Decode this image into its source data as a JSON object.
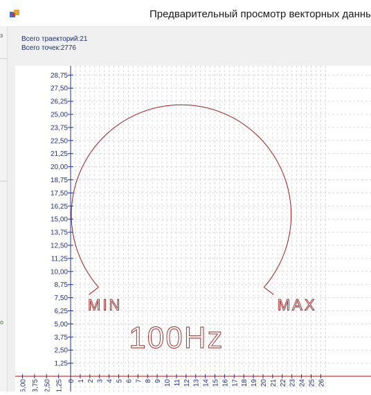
{
  "window": {
    "title": "Предварительный просмотр векторных данны"
  },
  "info": {
    "trajectories_label": "Всего траекторий:21",
    "points_label": "Всего точек:2776"
  },
  "side_fragments": [
    "з",
    "о"
  ],
  "chart_data": {
    "type": "line",
    "title": "",
    "xlabel": "",
    "ylabel": "",
    "grid": true,
    "xlim": [
      -5.0,
      26.5
    ],
    "ylim": [
      -1.0,
      29.5
    ],
    "y_ticks": [
      "1,25",
      "2,50",
      "3,75",
      "5,00",
      "6,25",
      "7,50",
      "8,75",
      "10,00",
      "11,25",
      "12,50",
      "13,75",
      "15,00",
      "16,25",
      "17,50",
      "18,75",
      "20,00",
      "21,25",
      "22,50",
      "23,75",
      "25,00",
      "26,25",
      "27,50",
      "28,75"
    ],
    "x_ticks": [
      "-5,00",
      "-3,75",
      "-2,50",
      "-1,25",
      "0",
      "1",
      "2",
      "3",
      "4",
      "5",
      "6",
      "7",
      "8",
      "9",
      "10",
      "11",
      "12",
      "13",
      "14",
      "15",
      "16",
      "17",
      "18",
      "19",
      "20",
      "21",
      "22",
      "23",
      "24",
      "25",
      "26"
    ],
    "dial_arc": {
      "center": [
        11.5,
        15.2
      ],
      "radius": 10.5,
      "start_point": [
        2.9,
        8.5
      ],
      "end_point": [
        20.1,
        8.5
      ],
      "hook_ends": [
        [
          1.9,
          7.8
        ],
        [
          21.1,
          7.8
        ]
      ]
    },
    "labels": [
      {
        "text": "MIN",
        "x": 1.8,
        "y": 6.3,
        "size": "small"
      },
      {
        "text": "MAX",
        "x": 21.5,
        "y": 6.3,
        "size": "small"
      },
      {
        "text": "100Hz",
        "x": 11.0,
        "y": 2.7,
        "size": "large"
      }
    ],
    "colors": {
      "trajectory": "#9b1c1c",
      "axis": "#1c2fa0",
      "tick_text": "#1c2f8a",
      "grid": "#d9d9d9",
      "zero_axis": "#c00000"
    }
  }
}
